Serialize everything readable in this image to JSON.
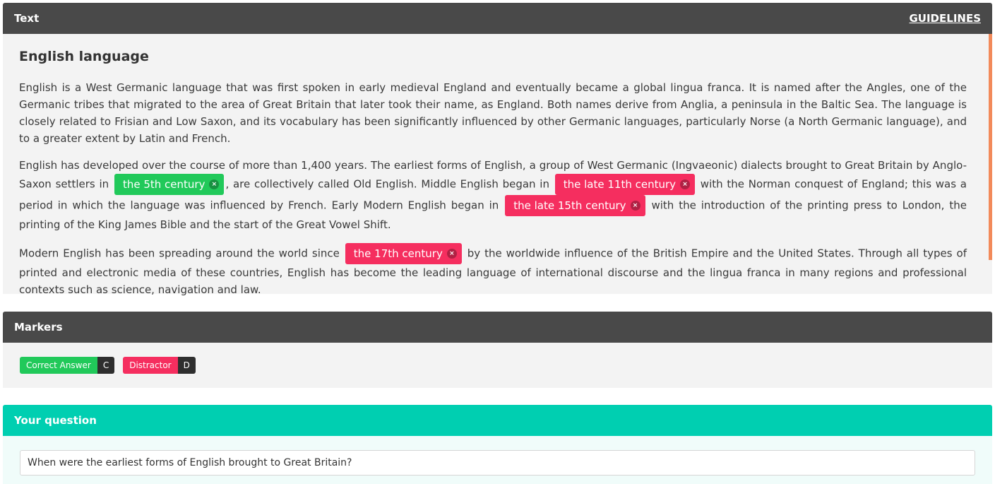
{
  "text_panel": {
    "header": "Text",
    "guidelines": "GUIDELINES",
    "title": "English language",
    "p1": "English is a West Germanic language that was first spoken in early medieval England and eventually became a global lingua franca. It is named after the Angles, one of the Germanic tribes that migrated to the area of Great Britain that later took their name, as England. Both names derive from Anglia, a peninsula in the Baltic Sea. The language is closely related to Frisian and Low Saxon, and its vocabulary has been significantly influenced by other Germanic languages, particularly Norse (a North Germanic language), and to a greater extent by Latin and French.",
    "p2": {
      "s1": "English has developed over the course of more than 1,400 years. The earliest forms of English, a group of West Germanic (Ingvaeonic) dialects brought to Great Britain by Anglo-Saxon settlers in",
      "tag1": "the 5th century",
      "s2": ", are collectively called Old English. Middle English began in",
      "tag2": "the late 11th century",
      "s3": "with the Norman conquest of England; this was a period in which the language was influenced by French. Early Modern English began in",
      "tag3": "the late 15th century",
      "s4": "with the introduction of the printing press to London, the printing of the King James Bible and the start of the Great Vowel Shift."
    },
    "p3": {
      "s1": "Modern English has been spreading around the world since",
      "tag1": "the 17th century",
      "s2": "by the worldwide influence of the British Empire and the United States. Through all types of printed and electronic media of these countries, English has become the leading language of international discourse and the lingua franca in many regions and professional contexts such as science, navigation and law."
    },
    "remove_glyph": "×"
  },
  "markers_panel": {
    "header": "Markers",
    "correct_label": "Correct Answer",
    "correct_key": "C",
    "distractor_label": "Distractor",
    "distractor_key": "D"
  },
  "question_panel": {
    "header": "Your question",
    "value": "When were the earliest forms of English brought to Great Britain?"
  },
  "colors": {
    "correct": "#21c95a",
    "distractor": "#f52e5f",
    "header_dark": "#494949",
    "header_teal": "#00cfb1",
    "scroll_thumb": "#f28a5a"
  }
}
